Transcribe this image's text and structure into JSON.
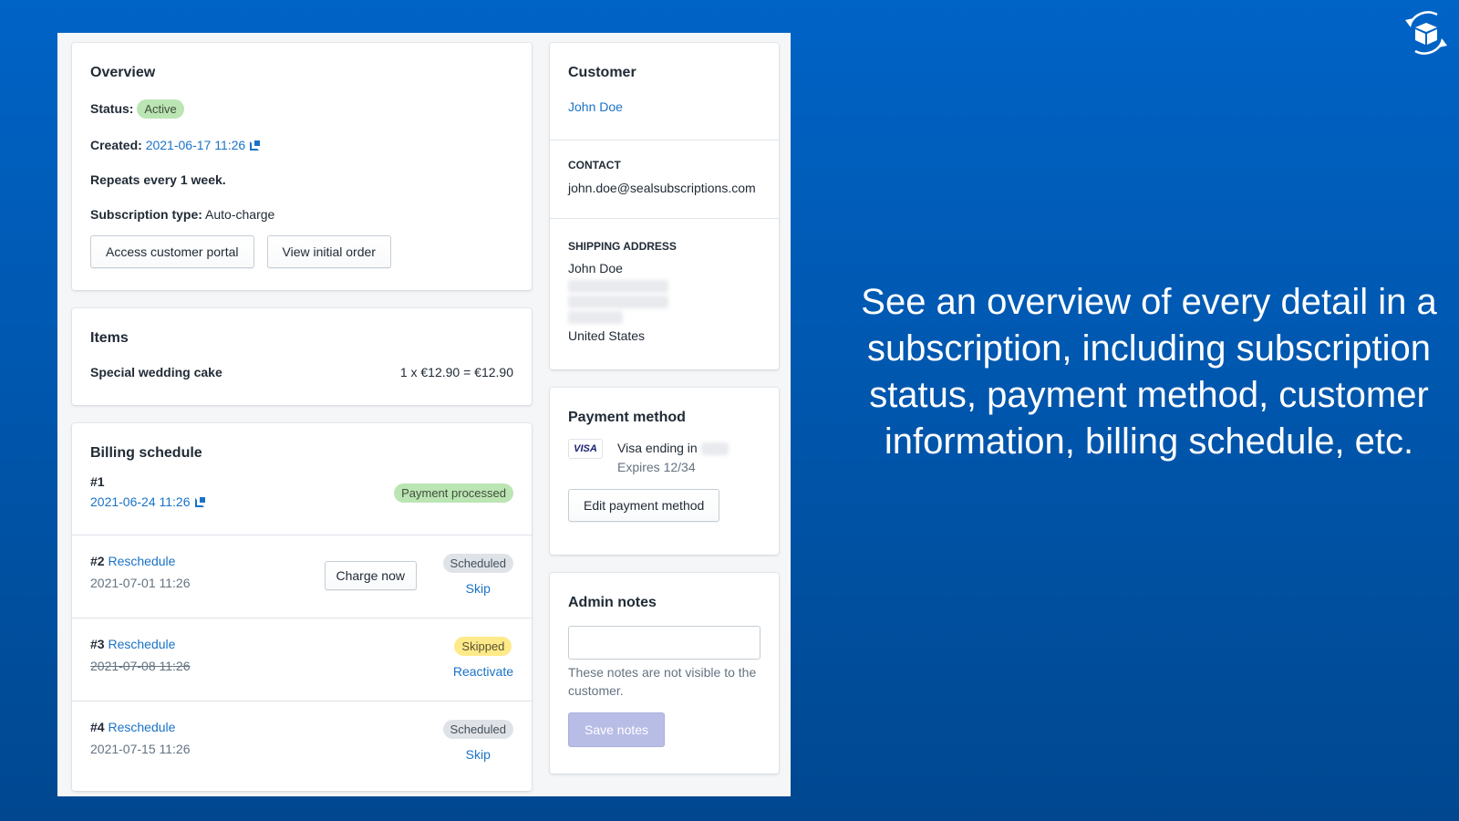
{
  "overview": {
    "title": "Overview",
    "status_label": "Status:",
    "status": "Active",
    "created_label": "Created:",
    "created": "2021-06-17 11:26",
    "repeats": "Repeats every 1 week.",
    "type_label": "Subscription type:",
    "type": "Auto-charge",
    "portal_button": "Access customer portal",
    "order_button": "View initial order"
  },
  "items": {
    "title": "Items",
    "list": [
      {
        "name": "Special wedding cake",
        "price": "1 x €12.90 = €12.90"
      }
    ]
  },
  "billing": {
    "title": "Billing schedule",
    "entries": [
      {
        "num": "#1",
        "date": "2021-06-24 11:26",
        "status": "Payment processed"
      },
      {
        "num": "#2",
        "action": "Reschedule",
        "date": "2021-07-01 11:26",
        "status": "Scheduled",
        "charge": "Charge now",
        "link": "Skip"
      },
      {
        "num": "#3",
        "action": "Reschedule",
        "date": "2021-07-08 11:26",
        "status": "Skipped",
        "link": "Reactivate"
      },
      {
        "num": "#4",
        "action": "Reschedule",
        "date": "2021-07-15 11:26",
        "status": "Scheduled",
        "link": "Skip"
      }
    ]
  },
  "customer": {
    "title": "Customer",
    "name": "John Doe",
    "contact_label": "Contact",
    "email": "john.doe@sealsubscriptions.com",
    "shipping_label": "Shipping address",
    "ship_name": "John Doe",
    "ship_country": "United States"
  },
  "payment": {
    "title": "Payment method",
    "brand": "VISA",
    "ending": "Visa ending in",
    "expires": "Expires 12/34",
    "edit_button": "Edit payment method"
  },
  "notes": {
    "title": "Admin notes",
    "value": "",
    "help": "These notes are not visible to the customer.",
    "save_button": "Save notes"
  },
  "slogan": "See an overview of every detail in a subscription, including subscription status, payment method, customer information, billing schedule, etc.",
  "colors": {
    "link": "#1a73c7",
    "active": "#bbe5b3",
    "skipped": "#ffea8a",
    "save": "#b8bde6"
  }
}
